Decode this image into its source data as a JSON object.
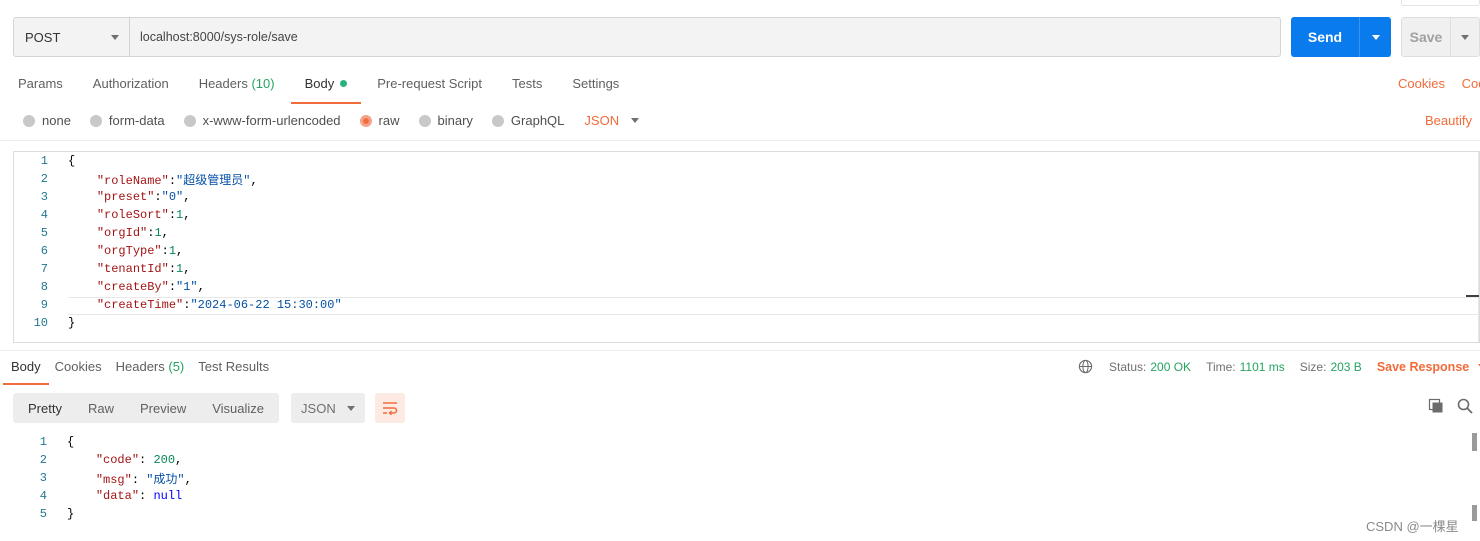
{
  "request": {
    "method": "POST",
    "url": "localhost:8000/sys-role/save",
    "send_label": "Send",
    "save_label": "Save"
  },
  "request_tabs": [
    {
      "label": "Params"
    },
    {
      "label": "Authorization"
    },
    {
      "label": "Headers",
      "count": "(10)"
    },
    {
      "label": "Body",
      "active": true
    },
    {
      "label": "Pre-request Script"
    },
    {
      "label": "Tests"
    },
    {
      "label": "Settings"
    }
  ],
  "right_links": {
    "cookies": "Cookies",
    "code": "Code"
  },
  "body_types": [
    "none",
    "form-data",
    "x-www-form-urlencoded",
    "raw",
    "binary",
    "GraphQL"
  ],
  "body_type_selected": "raw",
  "raw_format": "JSON",
  "beautify_label": "Beautify",
  "request_body_lines": [
    {
      "n": "1"
    },
    {
      "n": "2",
      "key": "\"roleName\"",
      "val": "\"超级管理员\"",
      "type": "s",
      "comma": ","
    },
    {
      "n": "3",
      "key": "\"preset\"",
      "val": "\"0\"",
      "type": "s",
      "comma": ","
    },
    {
      "n": "4",
      "key": "\"roleSort\"",
      "val": "1",
      "type": "n",
      "comma": ","
    },
    {
      "n": "5",
      "key": "\"orgId\"",
      "val": "1",
      "type": "n",
      "comma": ","
    },
    {
      "n": "6",
      "key": "\"orgType\"",
      "val": "1",
      "type": "n",
      "comma": ","
    },
    {
      "n": "7",
      "key": "\"tenantId\"",
      "val": "1",
      "type": "n",
      "comma": ","
    },
    {
      "n": "8",
      "key": "\"createBy\"",
      "val": "\"1\"",
      "type": "s",
      "comma": ","
    },
    {
      "n": "9",
      "key": "\"createTime\"",
      "val": "\"2024-06-22 15:30:00\"",
      "type": "s",
      "comma": ""
    },
    {
      "n": "10"
    }
  ],
  "response_tabs": [
    {
      "label": "Body",
      "active": true
    },
    {
      "label": "Cookies"
    },
    {
      "label": "Headers",
      "count": "(5)"
    },
    {
      "label": "Test Results"
    }
  ],
  "status": {
    "status_label": "Status:",
    "status_value": "200 OK",
    "time_label": "Time:",
    "time_value": "1101 ms",
    "size_label": "Size:",
    "size_value": "203 B",
    "save_response": "Save Response"
  },
  "view_modes": [
    "Pretty",
    "Raw",
    "Preview",
    "Visualize"
  ],
  "view_mode_selected": "Pretty",
  "response_format": "JSON",
  "response_body_lines": [
    {
      "n": "1"
    },
    {
      "n": "2",
      "key": "\"code\"",
      "val": "200",
      "type": "n",
      "comma": ","
    },
    {
      "n": "3",
      "key": "\"msg\"",
      "val": "\"成功\"",
      "type": "s",
      "comma": ","
    },
    {
      "n": "4",
      "key": "\"data\"",
      "val": "null",
      "type": "kw",
      "comma": ""
    },
    {
      "n": "5"
    }
  ],
  "watermark": "CSDN @一棵星",
  "colors": {
    "accent": "#f26b3a",
    "send": "#097bed",
    "success": "#26a360"
  }
}
